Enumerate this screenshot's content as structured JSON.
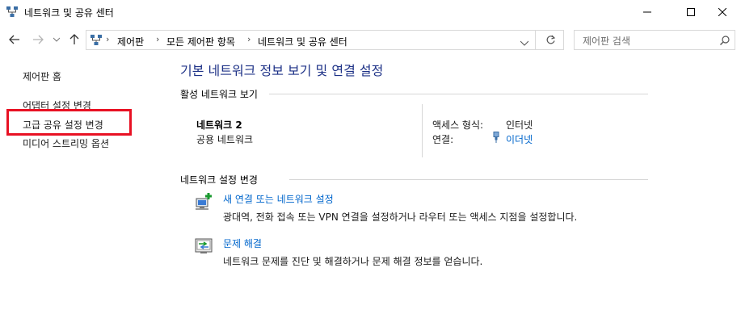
{
  "window": {
    "title": "네트워크 및 공유 센터",
    "controls": {
      "minimize": "─",
      "maximize": "☐",
      "close": "✕"
    }
  },
  "address_bar": {
    "breadcrumbs": [
      "제어판",
      "모든 제어판 항목",
      "네트워크 및 공유 센터"
    ],
    "separator": "›"
  },
  "search": {
    "placeholder": "제어판 검색"
  },
  "left_pane": {
    "home": "제어판 홈",
    "links": [
      "어댑터 설정 변경",
      "고급 공유 설정 변경",
      "미디어 스트리밍 옵션"
    ]
  },
  "main": {
    "heading": "기본 네트워크 정보 보기 및 연결 설정",
    "active_networks_title": "활성 네트워크 보기",
    "network": {
      "name": "네트워크 2",
      "category": "공용 네트워크",
      "access_type_label": "액세스 형식:",
      "access_type_value": "인터넷",
      "connections_label": "연결:",
      "connections_value": "이더넷"
    },
    "change_settings_title": "네트워크 설정 변경",
    "tasks": [
      {
        "icon": "new-connection-icon",
        "title": "새 연결 또는 네트워크 설정",
        "description": "광대역, 전화 접속 또는 VPN 연결을 설정하거나 라우터 또는 액세스 지점을 설정합니다."
      },
      {
        "icon": "troubleshoot-icon",
        "title": "문제 해결",
        "description": "네트워크 문제를 진단 및 해결하거나 문제 해결 정보를 얻습니다."
      }
    ]
  },
  "colors": {
    "heading": "#1e3287",
    "link": "#0066cc",
    "highlight": "#e81123"
  }
}
